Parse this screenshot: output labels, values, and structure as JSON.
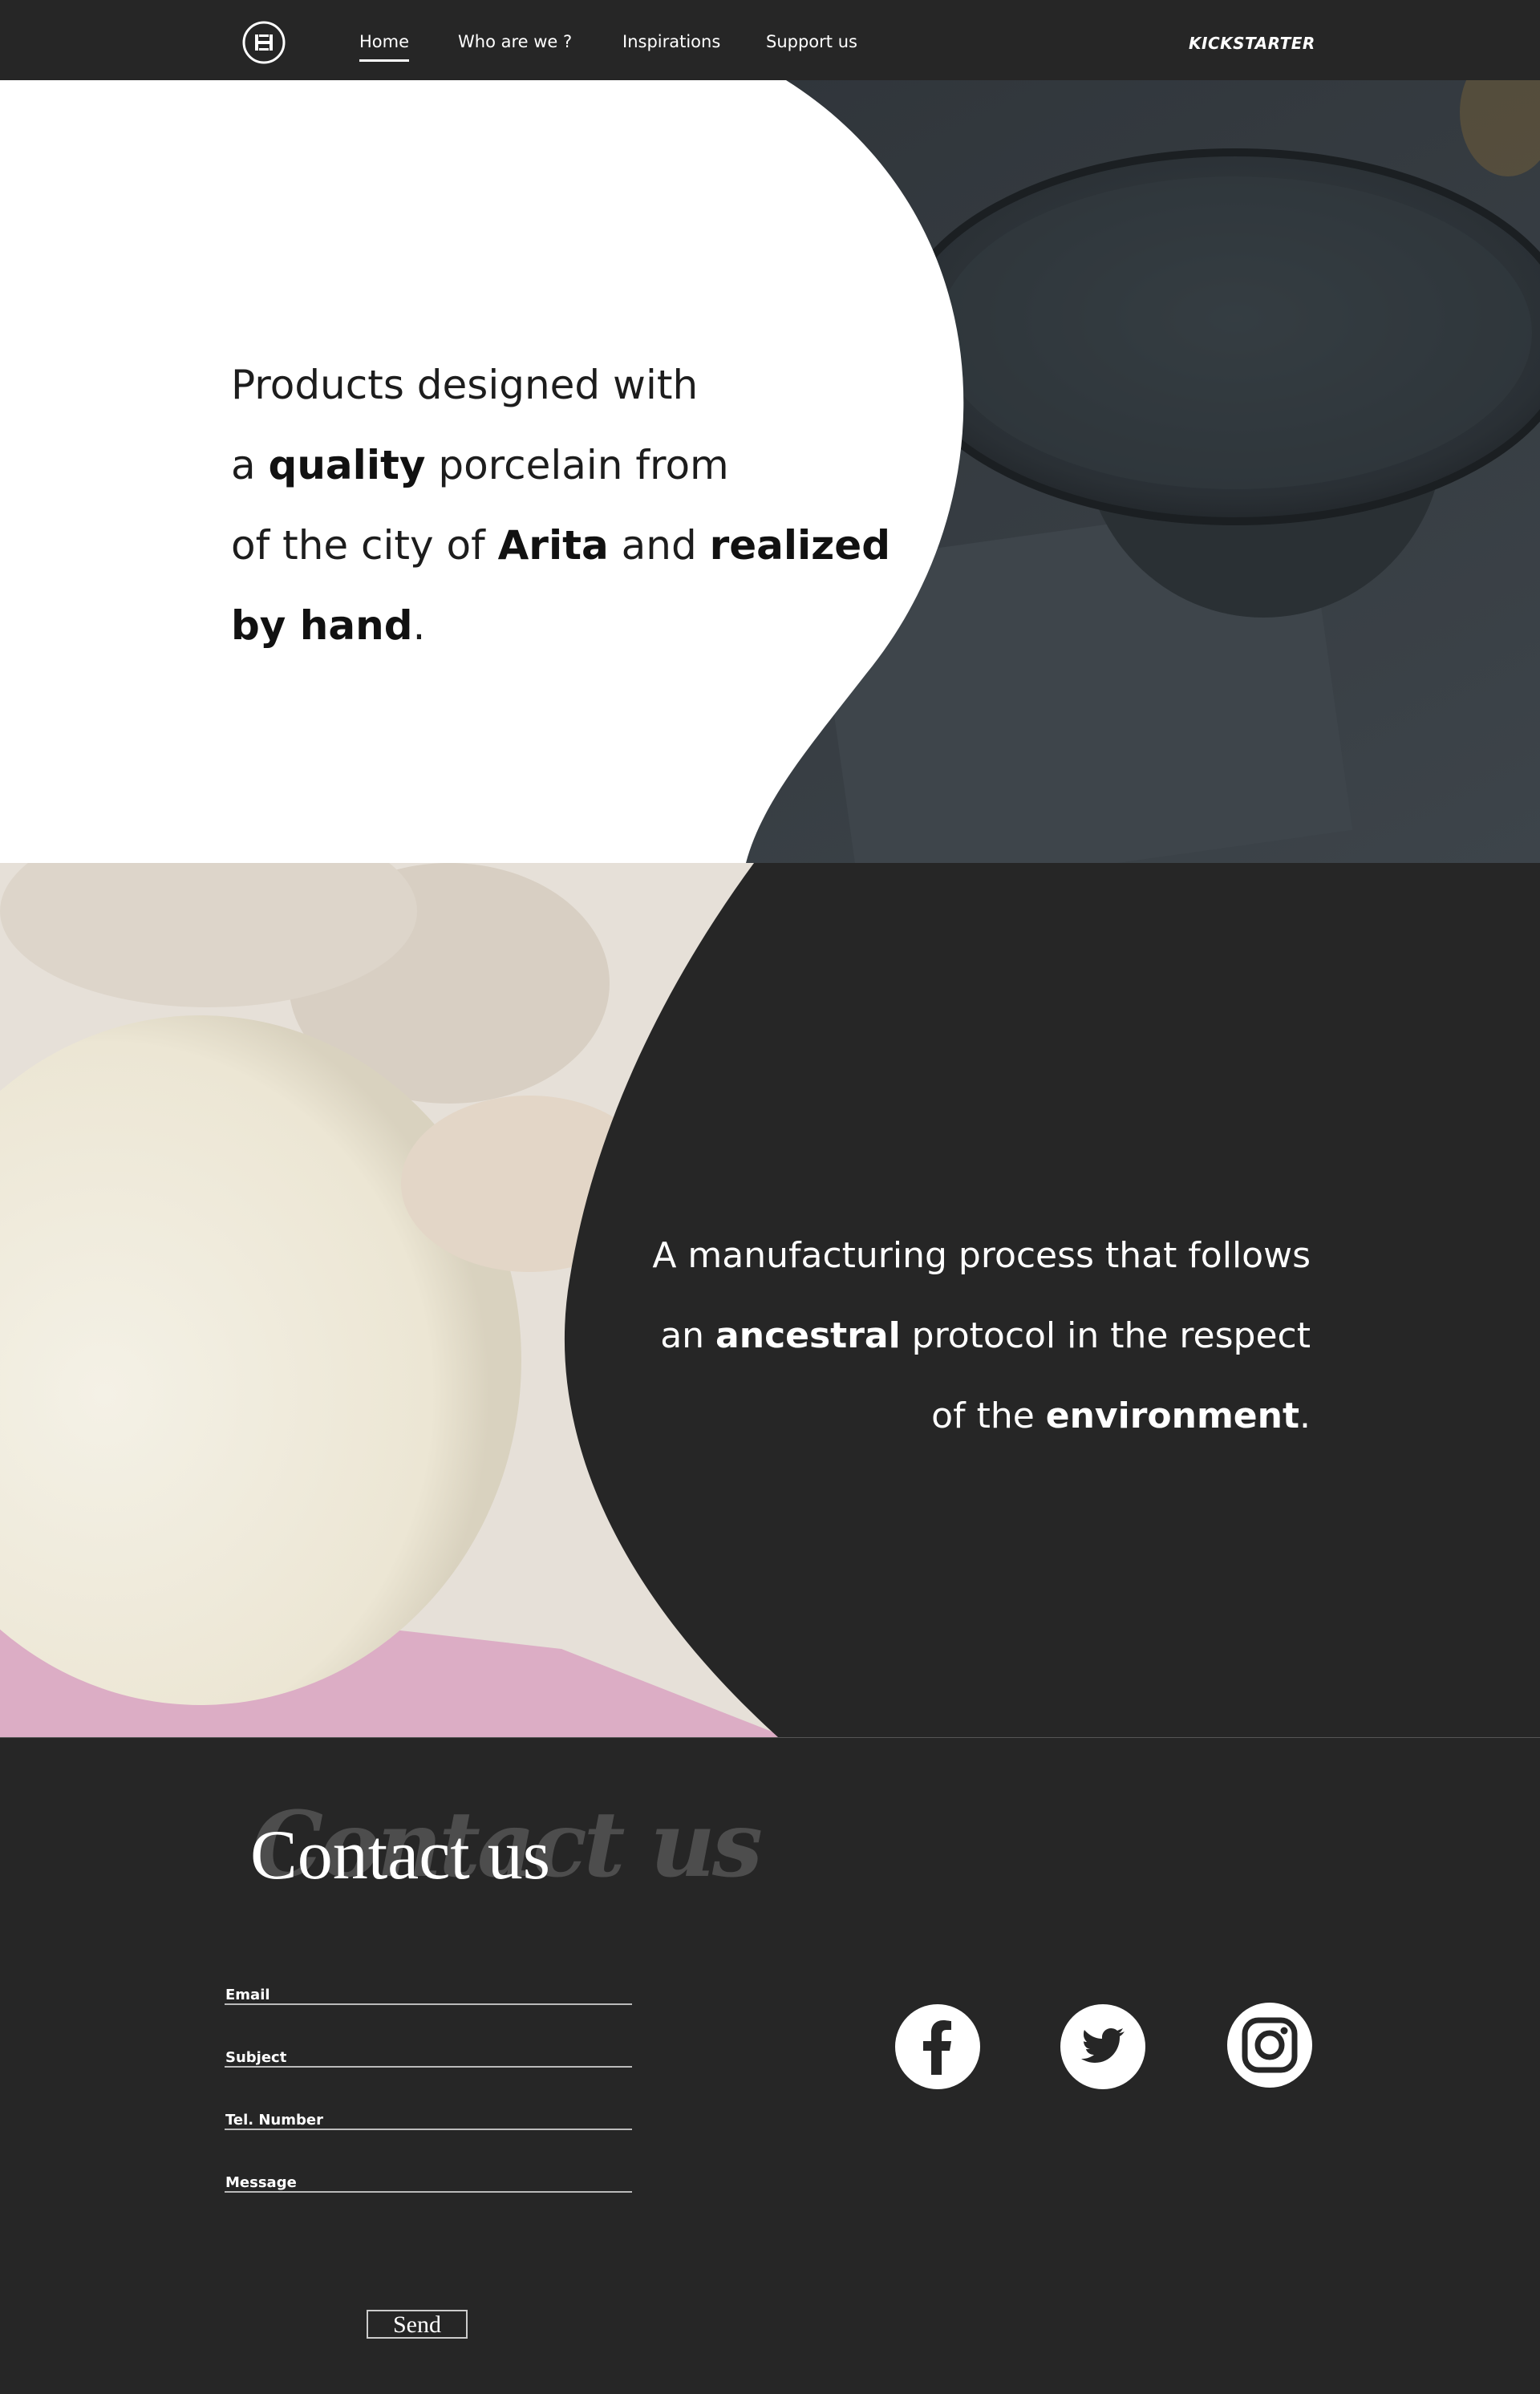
{
  "nav": {
    "items": [
      {
        "label": "Home",
        "active": true
      },
      {
        "label": "Who are we ?"
      },
      {
        "label": "Inspirations"
      },
      {
        "label": "Support us"
      }
    ],
    "kickstarter_label": "KICKSTARTER"
  },
  "hero": {
    "line1": "Products designed with",
    "line2_pre": "a ",
    "line2_bold": "quality",
    "line2_post": " porcelain from",
    "line3_pre": "of the city of ",
    "line3_bold1": "Arita",
    "line3_mid": " and ",
    "line3_bold2": "realized",
    "line4_bold": "by hand",
    "line4_post": "."
  },
  "process": {
    "line1": "A manufacturing process that follows",
    "line2_pre": "an ",
    "line2_bold": "ancestral",
    "line2_post": " protocol in the respect",
    "line3_pre": "of the ",
    "line3_bold": "environment",
    "line3_post": "."
  },
  "contact": {
    "title": "Contact us",
    "title_brush": "Contact us",
    "fields": {
      "email": "Email",
      "subject": "Subject",
      "tel": "Tel. Number",
      "message": "Message"
    },
    "send_label": "Send",
    "social": [
      "facebook-icon",
      "twitter-icon",
      "instagram-icon"
    ]
  },
  "colors": {
    "dark": "#262626",
    "white": "#ffffff",
    "accent_pink": "#d9a0c0"
  }
}
